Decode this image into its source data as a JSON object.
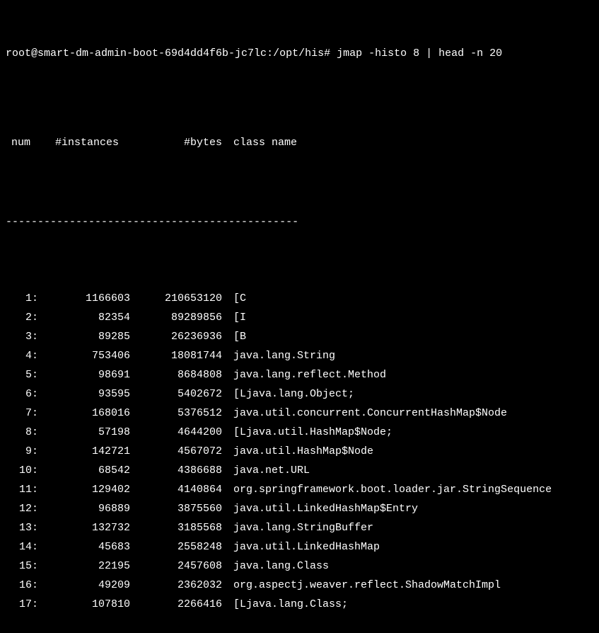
{
  "prompt": {
    "user_host": "root@smart-dm-admin-boot-69d4dd4f6b-jc7lc",
    "path": "/opt/his",
    "symbol": "#",
    "command": "jmap -histo 8 | head -n 20"
  },
  "headers": {
    "num": "num",
    "instances": "#instances",
    "bytes": "#bytes",
    "class_name": "class name"
  },
  "separator": "----------------------------------------------",
  "rows": [
    {
      "num": "1:",
      "instances": "1166603",
      "bytes": "210653120",
      "class_name": "[C"
    },
    {
      "num": "2:",
      "instances": "82354",
      "bytes": "89289856",
      "class_name": "[I"
    },
    {
      "num": "3:",
      "instances": "89285",
      "bytes": "26236936",
      "class_name": "[B"
    },
    {
      "num": "4:",
      "instances": "753406",
      "bytes": "18081744",
      "class_name": "java.lang.String"
    },
    {
      "num": "5:",
      "instances": "98691",
      "bytes": "8684808",
      "class_name": "java.lang.reflect.Method"
    },
    {
      "num": "6:",
      "instances": "93595",
      "bytes": "5402672",
      "class_name": "[Ljava.lang.Object;"
    },
    {
      "num": "7:",
      "instances": "168016",
      "bytes": "5376512",
      "class_name": "java.util.concurrent.ConcurrentHashMap$Node"
    },
    {
      "num": "8:",
      "instances": "57198",
      "bytes": "4644200",
      "class_name": "[Ljava.util.HashMap$Node;"
    },
    {
      "num": "9:",
      "instances": "142721",
      "bytes": "4567072",
      "class_name": "java.util.HashMap$Node"
    },
    {
      "num": "10:",
      "instances": "68542",
      "bytes": "4386688",
      "class_name": "java.net.URL"
    },
    {
      "num": "11:",
      "instances": "129402",
      "bytes": "4140864",
      "class_name": "org.springframework.boot.loader.jar.StringSequence"
    },
    {
      "num": "12:",
      "instances": "96889",
      "bytes": "3875560",
      "class_name": "java.util.LinkedHashMap$Entry"
    },
    {
      "num": "13:",
      "instances": "132732",
      "bytes": "3185568",
      "class_name": "java.lang.StringBuffer"
    },
    {
      "num": "14:",
      "instances": "45683",
      "bytes": "2558248",
      "class_name": "java.util.LinkedHashMap"
    },
    {
      "num": "15:",
      "instances": "22195",
      "bytes": "2457608",
      "class_name": "java.lang.Class"
    },
    {
      "num": "16:",
      "instances": "49209",
      "bytes": "2362032",
      "class_name": "org.aspectj.weaver.reflect.ShadowMatchImpl"
    },
    {
      "num": "17:",
      "instances": "107810",
      "bytes": "2266416",
      "class_name": "[Ljava.lang.Class;"
    }
  ]
}
